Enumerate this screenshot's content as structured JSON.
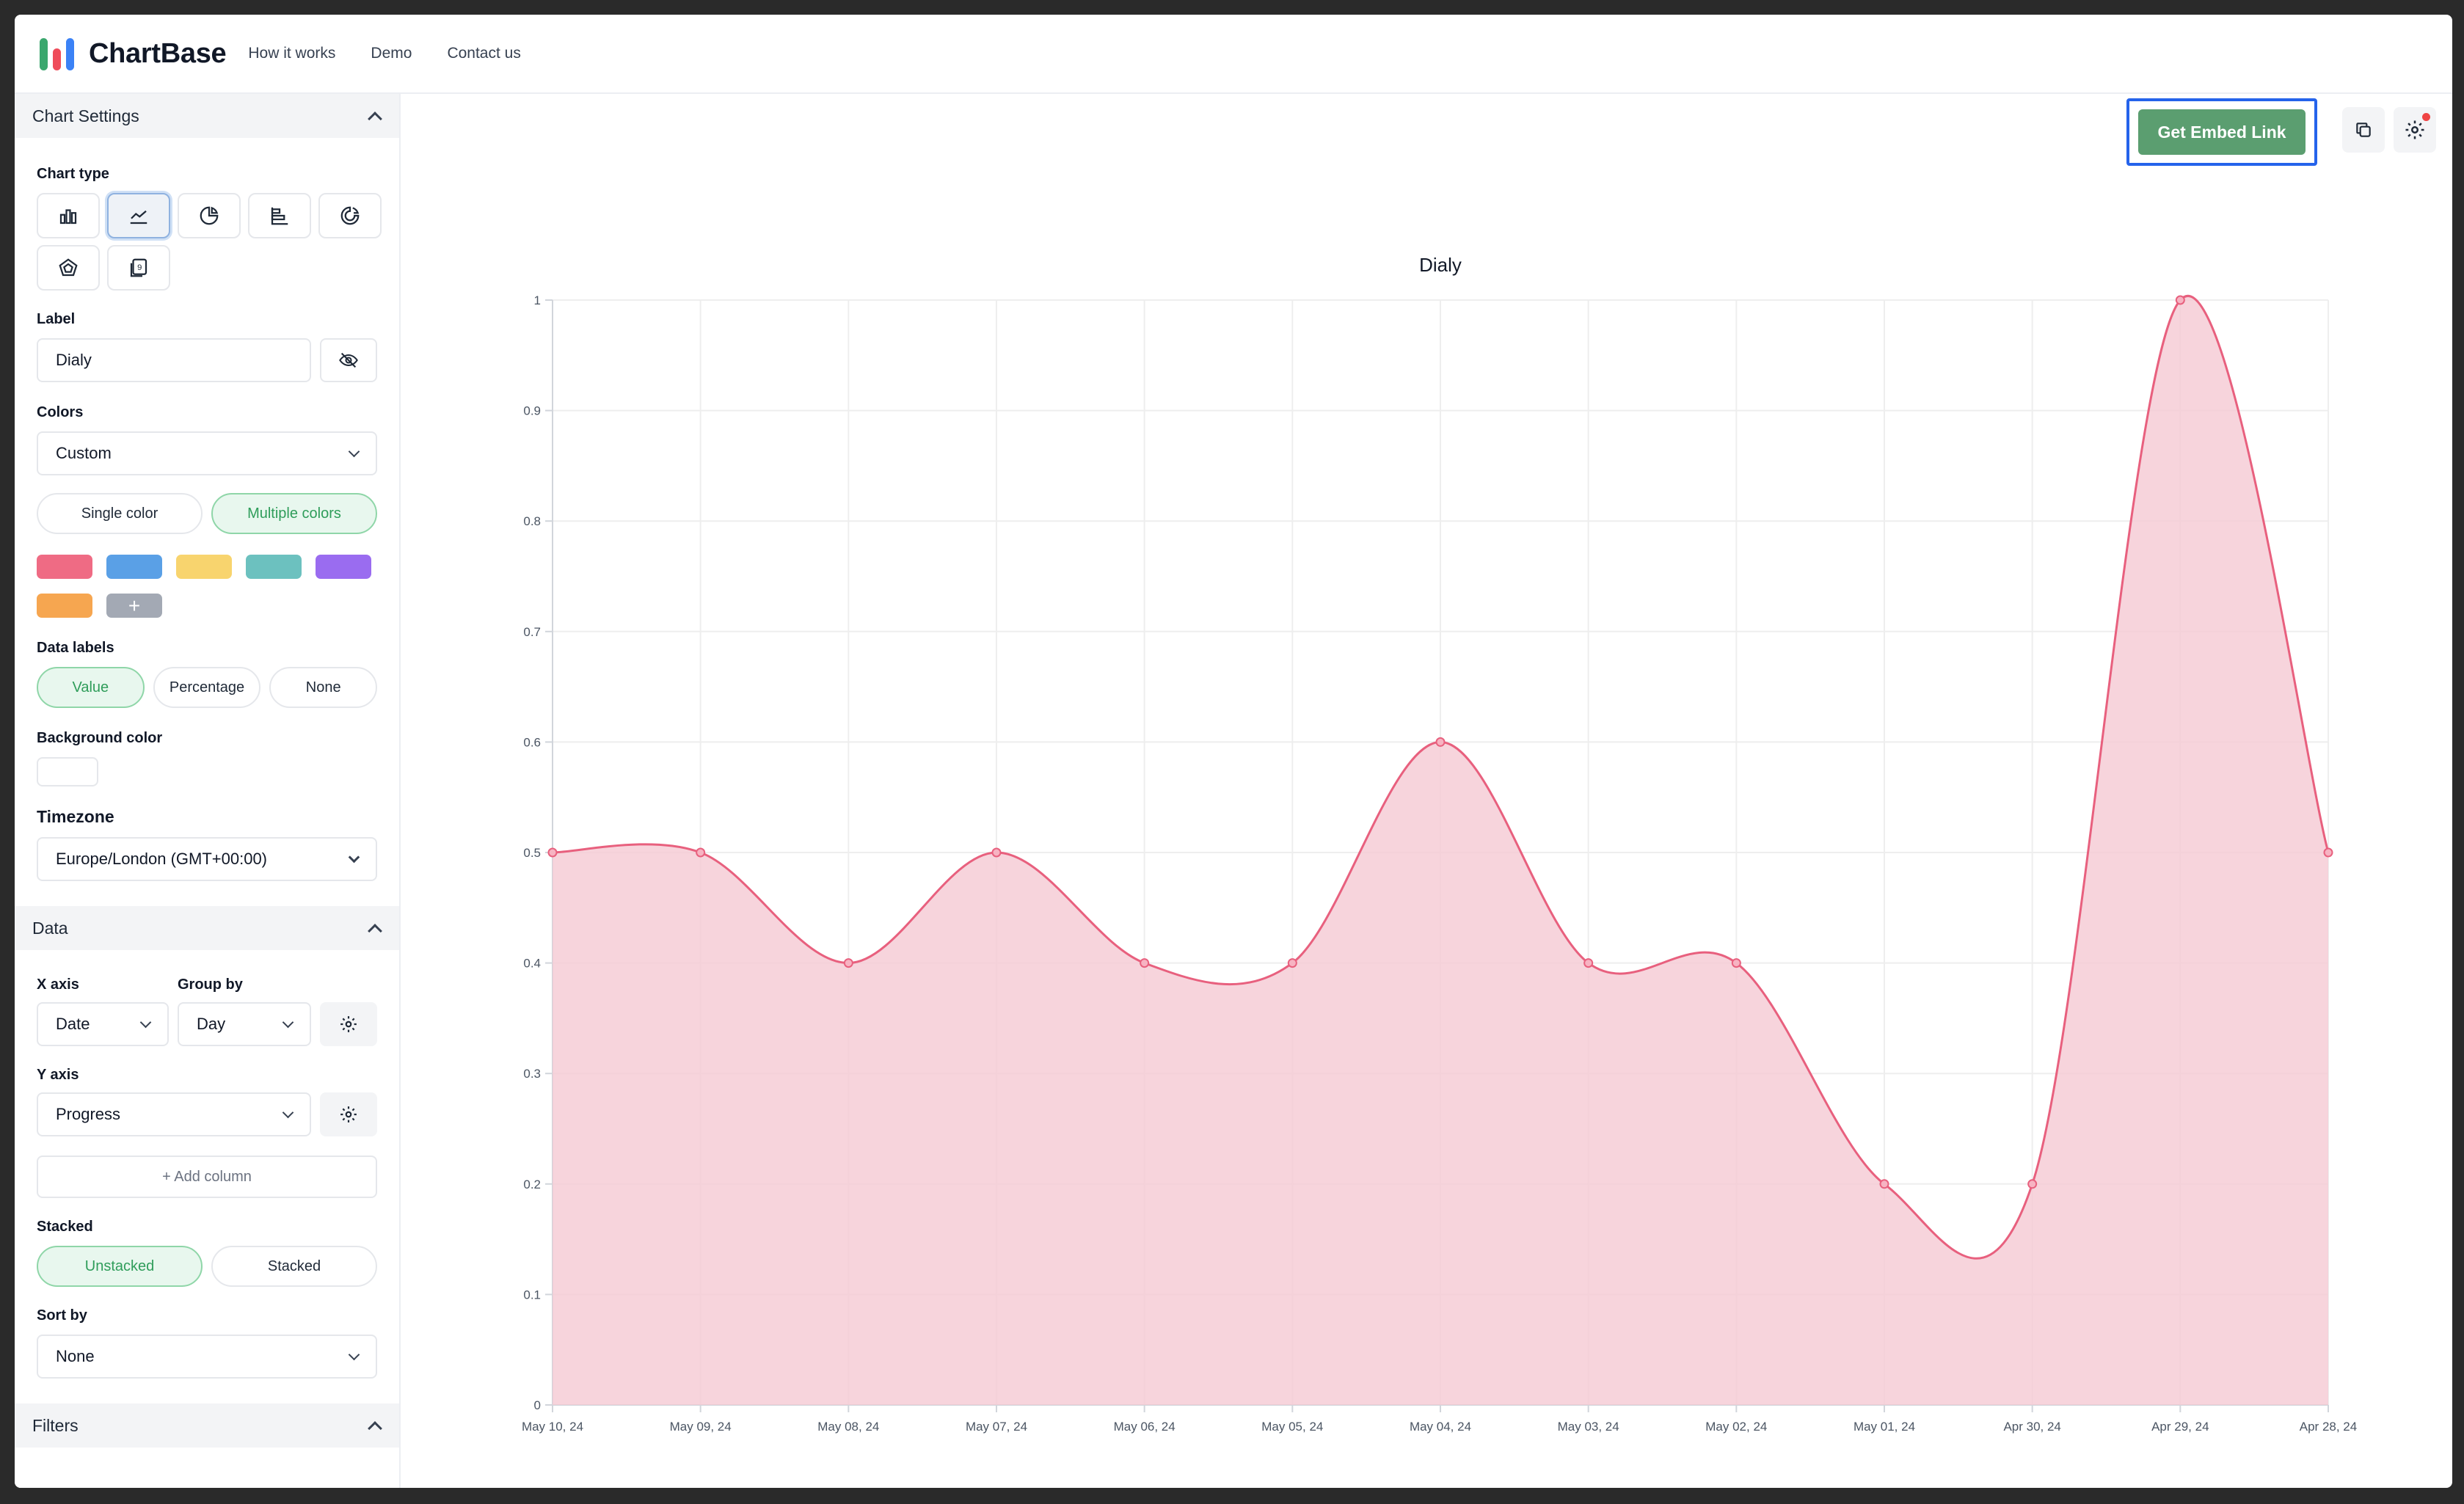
{
  "app": {
    "brand": "ChartBase",
    "brand_colors": [
      "#3aa76d",
      "#ef4c5a",
      "#3b82f6"
    ],
    "nav": [
      "How it works",
      "Demo",
      "Contact us"
    ]
  },
  "sidebar": {
    "chart_settings": {
      "title": "Chart Settings",
      "chart_type_label": "Chart type",
      "chart_types": [
        "bar-chart-icon",
        "line-chart-icon",
        "pie-chart-icon",
        "horizontal-bar-chart-icon",
        "donut-chart-icon",
        "radar-chart-icon",
        "number-card-icon"
      ],
      "selected_chart_type": "line-chart-icon",
      "label_label": "Label",
      "label_value": "Dialy",
      "colors_label": "Colors",
      "colors_value": "Custom",
      "color_modes": [
        "Single color",
        "Multiple colors"
      ],
      "selected_color_mode": "Multiple colors",
      "swatches": [
        "#ef6b84",
        "#5aa0e6",
        "#f8d46e",
        "#6cc1bf",
        "#9a6cf0",
        "#f6a650"
      ],
      "add_swatch": "+",
      "data_labels_label": "Data labels",
      "data_label_options": [
        "Value",
        "Percentage",
        "None"
      ],
      "selected_data_label": "Value",
      "background_color_label": "Background color",
      "background_color": "#ffffff",
      "timezone_label": "Timezone",
      "timezone_value": "Europe/London (GMT+00:00)"
    },
    "data": {
      "title": "Data",
      "x_axis_label": "X axis",
      "x_axis_value": "Date",
      "group_by_label": "Group by",
      "group_by_value": "Day",
      "y_axis_label": "Y axis",
      "y_axis_value": "Progress",
      "add_column": "+ Add column",
      "stacked_label": "Stacked",
      "stacked_options": [
        "Unstacked",
        "Stacked"
      ],
      "selected_stacked": "Unstacked",
      "sort_by_label": "Sort by",
      "sort_by_value": "None"
    },
    "filters": {
      "title": "Filters"
    }
  },
  "toolbar": {
    "embed_label": "Get Embed Link",
    "copy_icon": "copy-icon",
    "settings_icon": "gear-icon",
    "accent": "#5b9e70",
    "highlight": "#2563eb"
  },
  "chart_data": {
    "type": "area",
    "title": "Dialy",
    "x": [
      "May 10, 24",
      "May 09, 24",
      "May 08, 24",
      "May 07, 24",
      "May 06, 24",
      "May 05, 24",
      "May 04, 24",
      "May 03, 24",
      "May 02, 24",
      "May 01, 24",
      "Apr 30, 24",
      "Apr 29, 24",
      "Apr 28, 24"
    ],
    "values": [
      0.5,
      0.5,
      0.4,
      0.5,
      0.4,
      0.4,
      0.6,
      0.4,
      0.4,
      0.2,
      0.2,
      1,
      0.5
    ],
    "yticks": [
      "0",
      "0.1",
      "0.2",
      "0.3",
      "0.4",
      "0.5",
      "0.6",
      "0.7",
      "0.8",
      "0.9",
      "1"
    ],
    "ylim": [
      0,
      1
    ],
    "grid": true,
    "line_color": "#e8607e",
    "fill_color": "#f5c9d3"
  }
}
